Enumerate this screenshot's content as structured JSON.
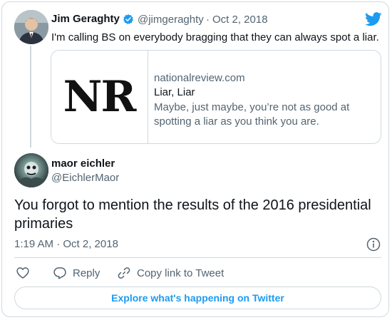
{
  "parent_tweet": {
    "author_name": "Jim Geraghty",
    "handle": "@jimgeraghty",
    "separator": "·",
    "date": "Oct 2, 2018",
    "text": "I'm calling BS on everybody bragging that they can always spot a liar.",
    "verified": true,
    "link_card": {
      "logo_text": "NR",
      "domain": "nationalreview.com",
      "title": "Liar, Liar",
      "description": "Maybe, just maybe, you’re not as good at spotting a liar as you think you are."
    }
  },
  "main_tweet": {
    "author_name": "maor eichler",
    "handle": "@EichlerMaor",
    "text": "You forgot to mention the results of the 2016 presidential primaries",
    "timestamp": "1:19 AM · Oct 2, 2018"
  },
  "actions": {
    "reply_label": "Reply",
    "copy_label": "Copy link to Tweet"
  },
  "explore_label": "Explore what's happening on Twitter",
  "colors": {
    "twitter_blue": "#1d9bf0",
    "text_primary": "#0f1419",
    "text_secondary": "#536471",
    "border": "#cfd9de"
  },
  "icons": [
    "verified-badge-icon",
    "twitter-bird-icon",
    "info-icon",
    "heart-icon",
    "reply-icon",
    "link-icon"
  ]
}
